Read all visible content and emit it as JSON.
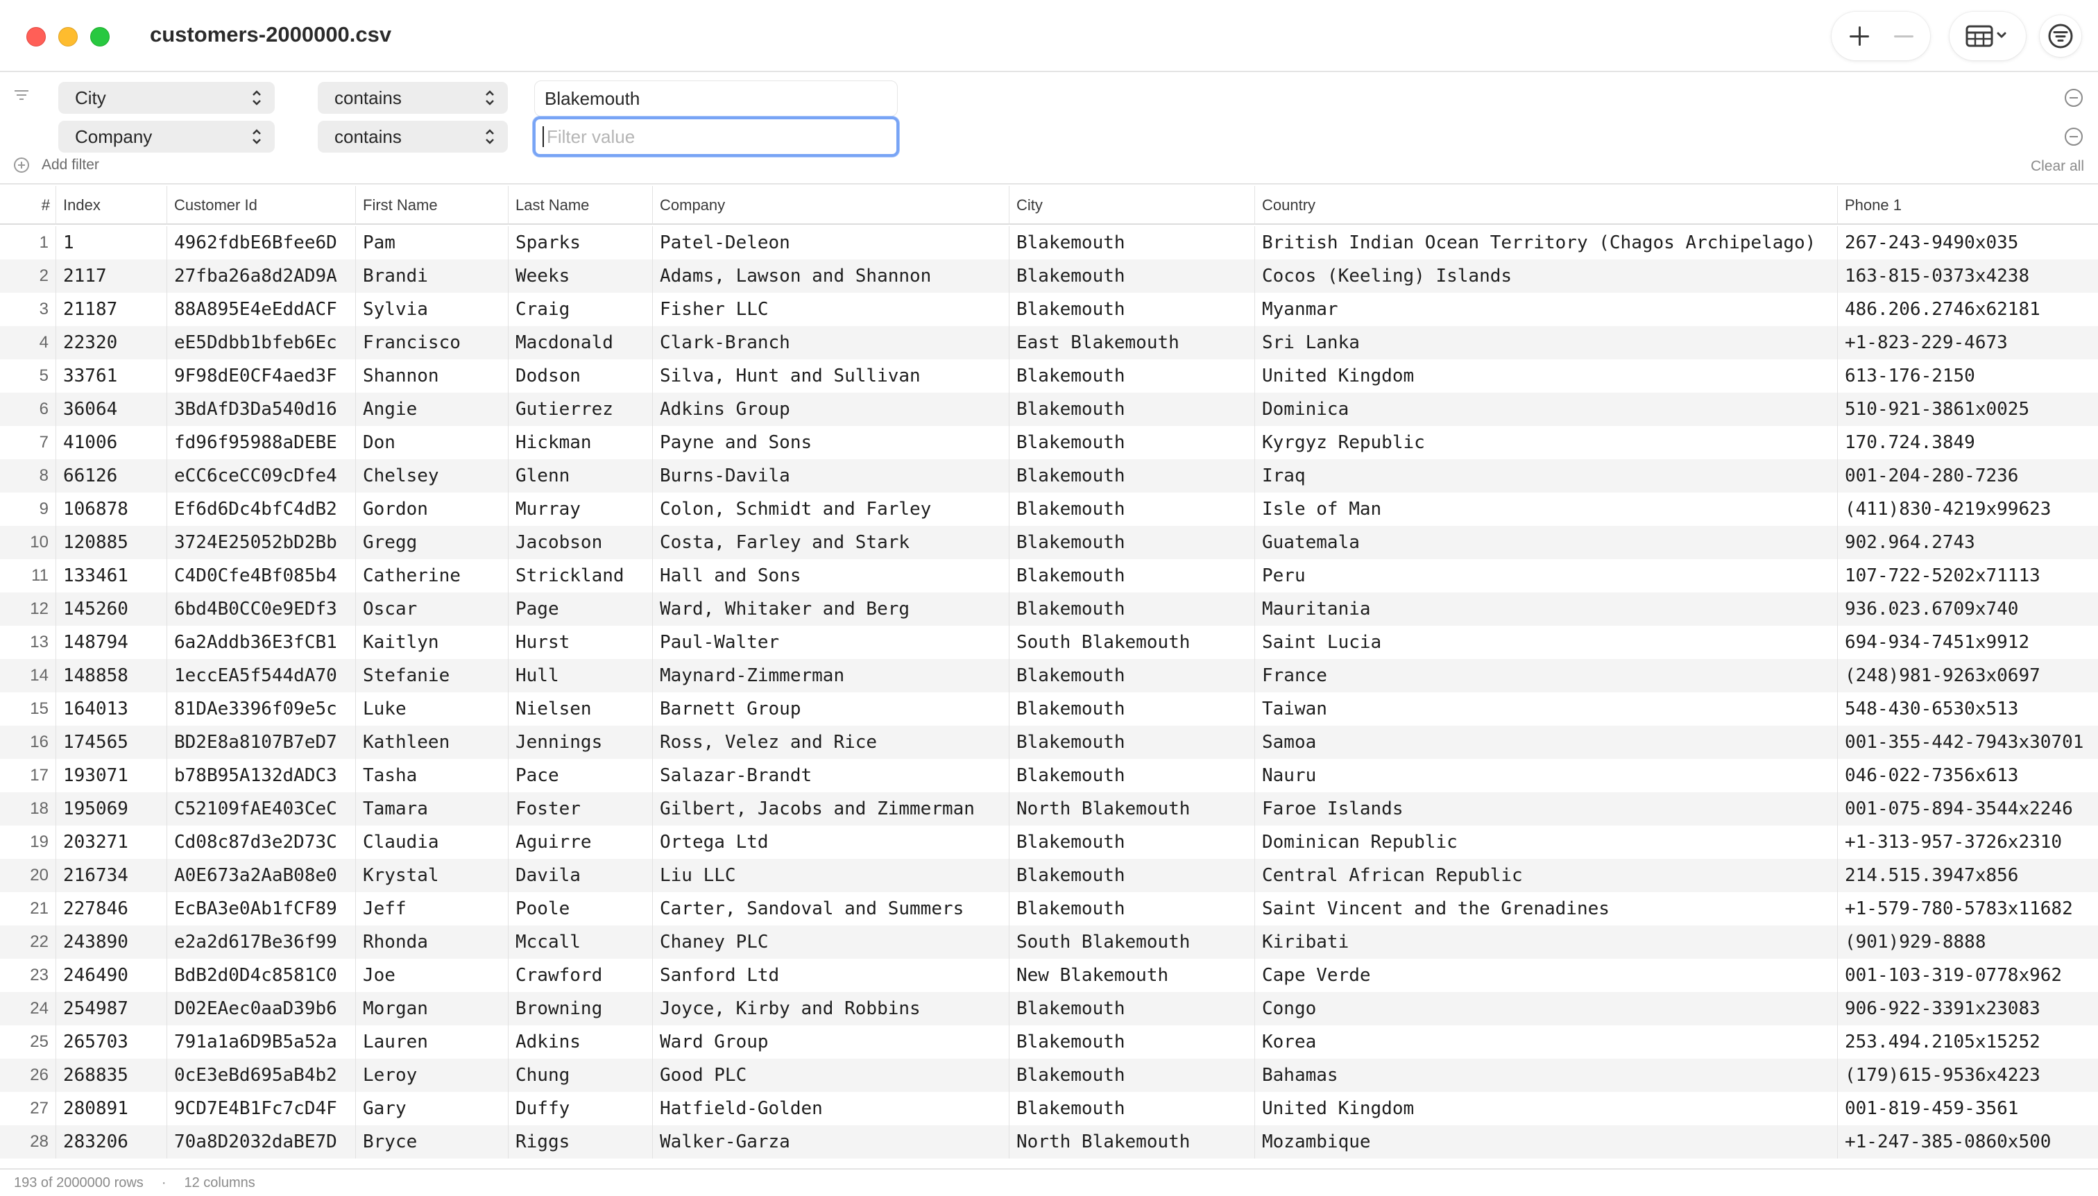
{
  "window": {
    "title": "customers-2000000.csv"
  },
  "toolbar": {
    "add_icon": "plus-icon",
    "remove_icon": "minus-icon",
    "view_icon": "table-view-icon",
    "filter_icon": "filter-icon"
  },
  "filters": [
    {
      "column": "City",
      "operator": "contains",
      "value": "Blakemouth",
      "placeholder": "Filter value"
    },
    {
      "column": "Company",
      "operator": "contains",
      "value": "",
      "placeholder": "Filter value"
    }
  ],
  "filter_panel": {
    "add_label": "Add filter",
    "clear_label": "Clear all"
  },
  "table": {
    "columns": [
      "#",
      "Index",
      "Customer Id",
      "First Name",
      "Last Name",
      "Company",
      "City",
      "Country",
      "Phone 1"
    ],
    "rows": [
      [
        "1",
        "1",
        "4962fdbE6Bfee6D",
        "Pam",
        "Sparks",
        "Patel-Deleon",
        "Blakemouth",
        "British Indian Ocean Territory (Chagos Archipelago)",
        "267-243-9490x035"
      ],
      [
        "2",
        "2117",
        "27fba26a8d2AD9A",
        "Brandi",
        "Weeks",
        "Adams, Lawson and Shannon",
        "Blakemouth",
        "Cocos (Keeling) Islands",
        "163-815-0373x4238"
      ],
      [
        "3",
        "21187",
        "88A895E4eEddACF",
        "Sylvia",
        "Craig",
        "Fisher LLC",
        "Blakemouth",
        "Myanmar",
        "486.206.2746x62181"
      ],
      [
        "4",
        "22320",
        "eE5Ddbb1bfeb6Ec",
        "Francisco",
        "Macdonald",
        "Clark-Branch",
        "East Blakemouth",
        "Sri Lanka",
        "+1-823-229-4673"
      ],
      [
        "5",
        "33761",
        "9F98dE0CF4aed3F",
        "Shannon",
        "Dodson",
        "Silva, Hunt and Sullivan",
        "Blakemouth",
        "United Kingdom",
        "613-176-2150"
      ],
      [
        "6",
        "36064",
        "3BdAfD3Da540d16",
        "Angie",
        "Gutierrez",
        "Adkins Group",
        "Blakemouth",
        "Dominica",
        "510-921-3861x0025"
      ],
      [
        "7",
        "41006",
        "fd96f95988aDEBE",
        "Don",
        "Hickman",
        "Payne and Sons",
        "Blakemouth",
        "Kyrgyz Republic",
        "170.724.3849"
      ],
      [
        "8",
        "66126",
        "eCC6ceCC09cDfe4",
        "Chelsey",
        "Glenn",
        "Burns-Davila",
        "Blakemouth",
        "Iraq",
        "001-204-280-7236"
      ],
      [
        "9",
        "106878",
        "Ef6d6Dc4bfC4dB2",
        "Gordon",
        "Murray",
        "Colon, Schmidt and Farley",
        "Blakemouth",
        "Isle of Man",
        "(411)830-4219x99623"
      ],
      [
        "10",
        "120885",
        "3724E25052bD2Bb",
        "Gregg",
        "Jacobson",
        "Costa, Farley and Stark",
        "Blakemouth",
        "Guatemala",
        "902.964.2743"
      ],
      [
        "11",
        "133461",
        "C4D0Cfe4Bf085b4",
        "Catherine",
        "Strickland",
        "Hall and Sons",
        "Blakemouth",
        "Peru",
        "107-722-5202x71113"
      ],
      [
        "12",
        "145260",
        "6bd4B0CC0e9EDf3",
        "Oscar",
        "Page",
        "Ward, Whitaker and Berg",
        "Blakemouth",
        "Mauritania",
        "936.023.6709x740"
      ],
      [
        "13",
        "148794",
        "6a2Addb36E3fCB1",
        "Kaitlyn",
        "Hurst",
        "Paul-Walter",
        "South Blakemouth",
        "Saint Lucia",
        "694-934-7451x9912"
      ],
      [
        "14",
        "148858",
        "1eccEA5f544dA70",
        "Stefanie",
        "Hull",
        "Maynard-Zimmerman",
        "Blakemouth",
        "France",
        "(248)981-9263x0697"
      ],
      [
        "15",
        "164013",
        "81DAe3396f09e5c",
        "Luke",
        "Nielsen",
        "Barnett Group",
        "Blakemouth",
        "Taiwan",
        "548-430-6530x513"
      ],
      [
        "16",
        "174565",
        "BD2E8a8107B7eD7",
        "Kathleen",
        "Jennings",
        "Ross, Velez and Rice",
        "Blakemouth",
        "Samoa",
        "001-355-442-7943x30701"
      ],
      [
        "17",
        "193071",
        "b78B95A132dADC3",
        "Tasha",
        "Pace",
        "Salazar-Brandt",
        "Blakemouth",
        "Nauru",
        "046-022-7356x613"
      ],
      [
        "18",
        "195069",
        "C52109fAE403CeC",
        "Tamara",
        "Foster",
        "Gilbert, Jacobs and Zimmerman",
        "North Blakemouth",
        "Faroe Islands",
        "001-075-894-3544x2246"
      ],
      [
        "19",
        "203271",
        "Cd08c87d3e2D73C",
        "Claudia",
        "Aguirre",
        "Ortega Ltd",
        "Blakemouth",
        "Dominican Republic",
        "+1-313-957-3726x2310"
      ],
      [
        "20",
        "216734",
        "A0E673a2AaB08e0",
        "Krystal",
        "Davila",
        "Liu LLC",
        "Blakemouth",
        "Central African Republic",
        "214.515.3947x856"
      ],
      [
        "21",
        "227846",
        "EcBA3e0Ab1fCF89",
        "Jeff",
        "Poole",
        "Carter, Sandoval and Summers",
        "Blakemouth",
        "Saint Vincent and the Grenadines",
        "+1-579-780-5783x11682"
      ],
      [
        "22",
        "243890",
        "e2a2d617Be36f99",
        "Rhonda",
        "Mccall",
        "Chaney PLC",
        "South Blakemouth",
        "Kiribati",
        "(901)929-8888"
      ],
      [
        "23",
        "246490",
        "BdB2d0D4c8581C0",
        "Joe",
        "Crawford",
        "Sanford Ltd",
        "New Blakemouth",
        "Cape Verde",
        "001-103-319-0778x962"
      ],
      [
        "24",
        "254987",
        "D02EAec0aaD39b6",
        "Morgan",
        "Browning",
        "Joyce, Kirby and Robbins",
        "Blakemouth",
        "Congo",
        "906-922-3391x23083"
      ],
      [
        "25",
        "265703",
        "791a1a6D9B5a52a",
        "Lauren",
        "Adkins",
        "Ward Group",
        "Blakemouth",
        "Korea",
        "253.494.2105x15252"
      ],
      [
        "26",
        "268835",
        "0cE3eBd695aB4b2",
        "Leroy",
        "Chung",
        "Good PLC",
        "Blakemouth",
        "Bahamas",
        "(179)615-9536x4223"
      ],
      [
        "27",
        "280891",
        "9CD7E4B1Fc7cD4F",
        "Gary",
        "Duffy",
        "Hatfield-Golden",
        "Blakemouth",
        "United Kingdom",
        "001-819-459-3561"
      ],
      [
        "28",
        "283206",
        "70a8D2032daBE7D",
        "Bryce",
        "Riggs",
        "Walker-Garza",
        "North Blakemouth",
        "Mozambique",
        "+1-247-385-0860x500"
      ]
    ]
  },
  "status": {
    "rows": "193 of 2000000 rows",
    "columns": "12 columns"
  },
  "colors": {
    "close": "#ff5f57",
    "minimize": "#febc2e",
    "maximize": "#28c840",
    "focus_ring": "#78a4f5",
    "stripe": "#f4f4f4"
  }
}
